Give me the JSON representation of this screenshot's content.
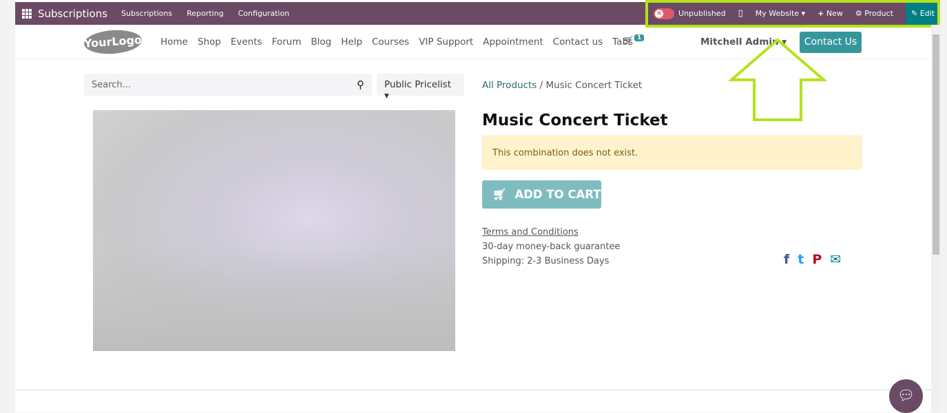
{
  "topbar": {
    "app": "Subscriptions",
    "menus": [
      "Subscriptions",
      "Reporting",
      "Configuration"
    ],
    "publish_status": "Unpublished",
    "website": "My Website",
    "new": "New",
    "product": "Product",
    "edit": "Edit"
  },
  "nav": {
    "logo": "YourLogo",
    "links": [
      "Home",
      "Shop",
      "Events",
      "Forum",
      "Blog",
      "Help",
      "Courses",
      "VIP Support",
      "Appointment",
      "Contact us",
      "Tabs"
    ],
    "cart_count": "1",
    "user": "Mitchell Admin",
    "contact": "Contact Us"
  },
  "search": {
    "placeholder": "Search...",
    "pricelist": "Public Pricelist"
  },
  "breadcrumb": {
    "parent": "All Products",
    "sep": "/",
    "current": "Music Concert Ticket"
  },
  "product": {
    "title": "Music Concert Ticket",
    "alert": "This combination does not exist.",
    "add_to_cart": "ADD TO CART",
    "terms": "Terms and Conditions",
    "guarantee": "30-day money-back guarantee",
    "shipping": "Shipping: 2-3 Business Days"
  },
  "colors": {
    "topbar": "#6a4a64",
    "accent": "#35979c",
    "highlight": "#b4e21a"
  }
}
